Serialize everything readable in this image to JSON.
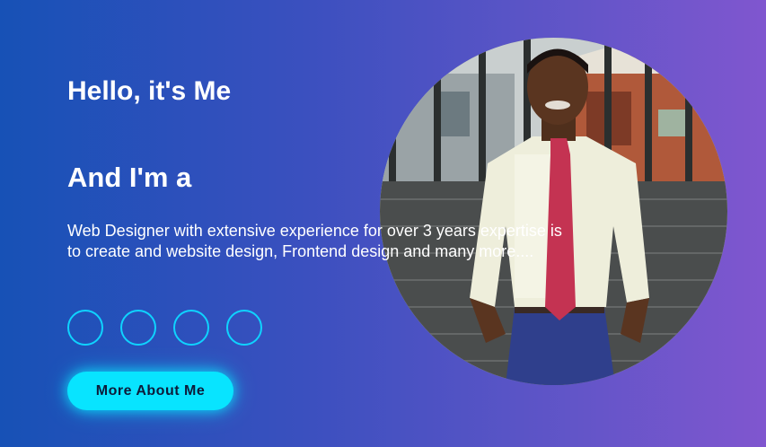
{
  "hero": {
    "greeting": "Hello, it's Me",
    "role_prefix": "And I'm a",
    "bio": "Web Designer with extensive experience for over 3 years expertise is to create and website design, Frontend design and many more....",
    "cta_label": "More About Me"
  },
  "socials": [
    {
      "icon": "social-icon-1"
    },
    {
      "icon": "social-icon-2"
    },
    {
      "icon": "social-icon-3"
    },
    {
      "icon": "social-icon-4"
    }
  ],
  "colors": {
    "gradient_start": "#1751b6",
    "gradient_end": "#8056cf",
    "accent": "#08e4ff",
    "text": "#ffffff"
  }
}
